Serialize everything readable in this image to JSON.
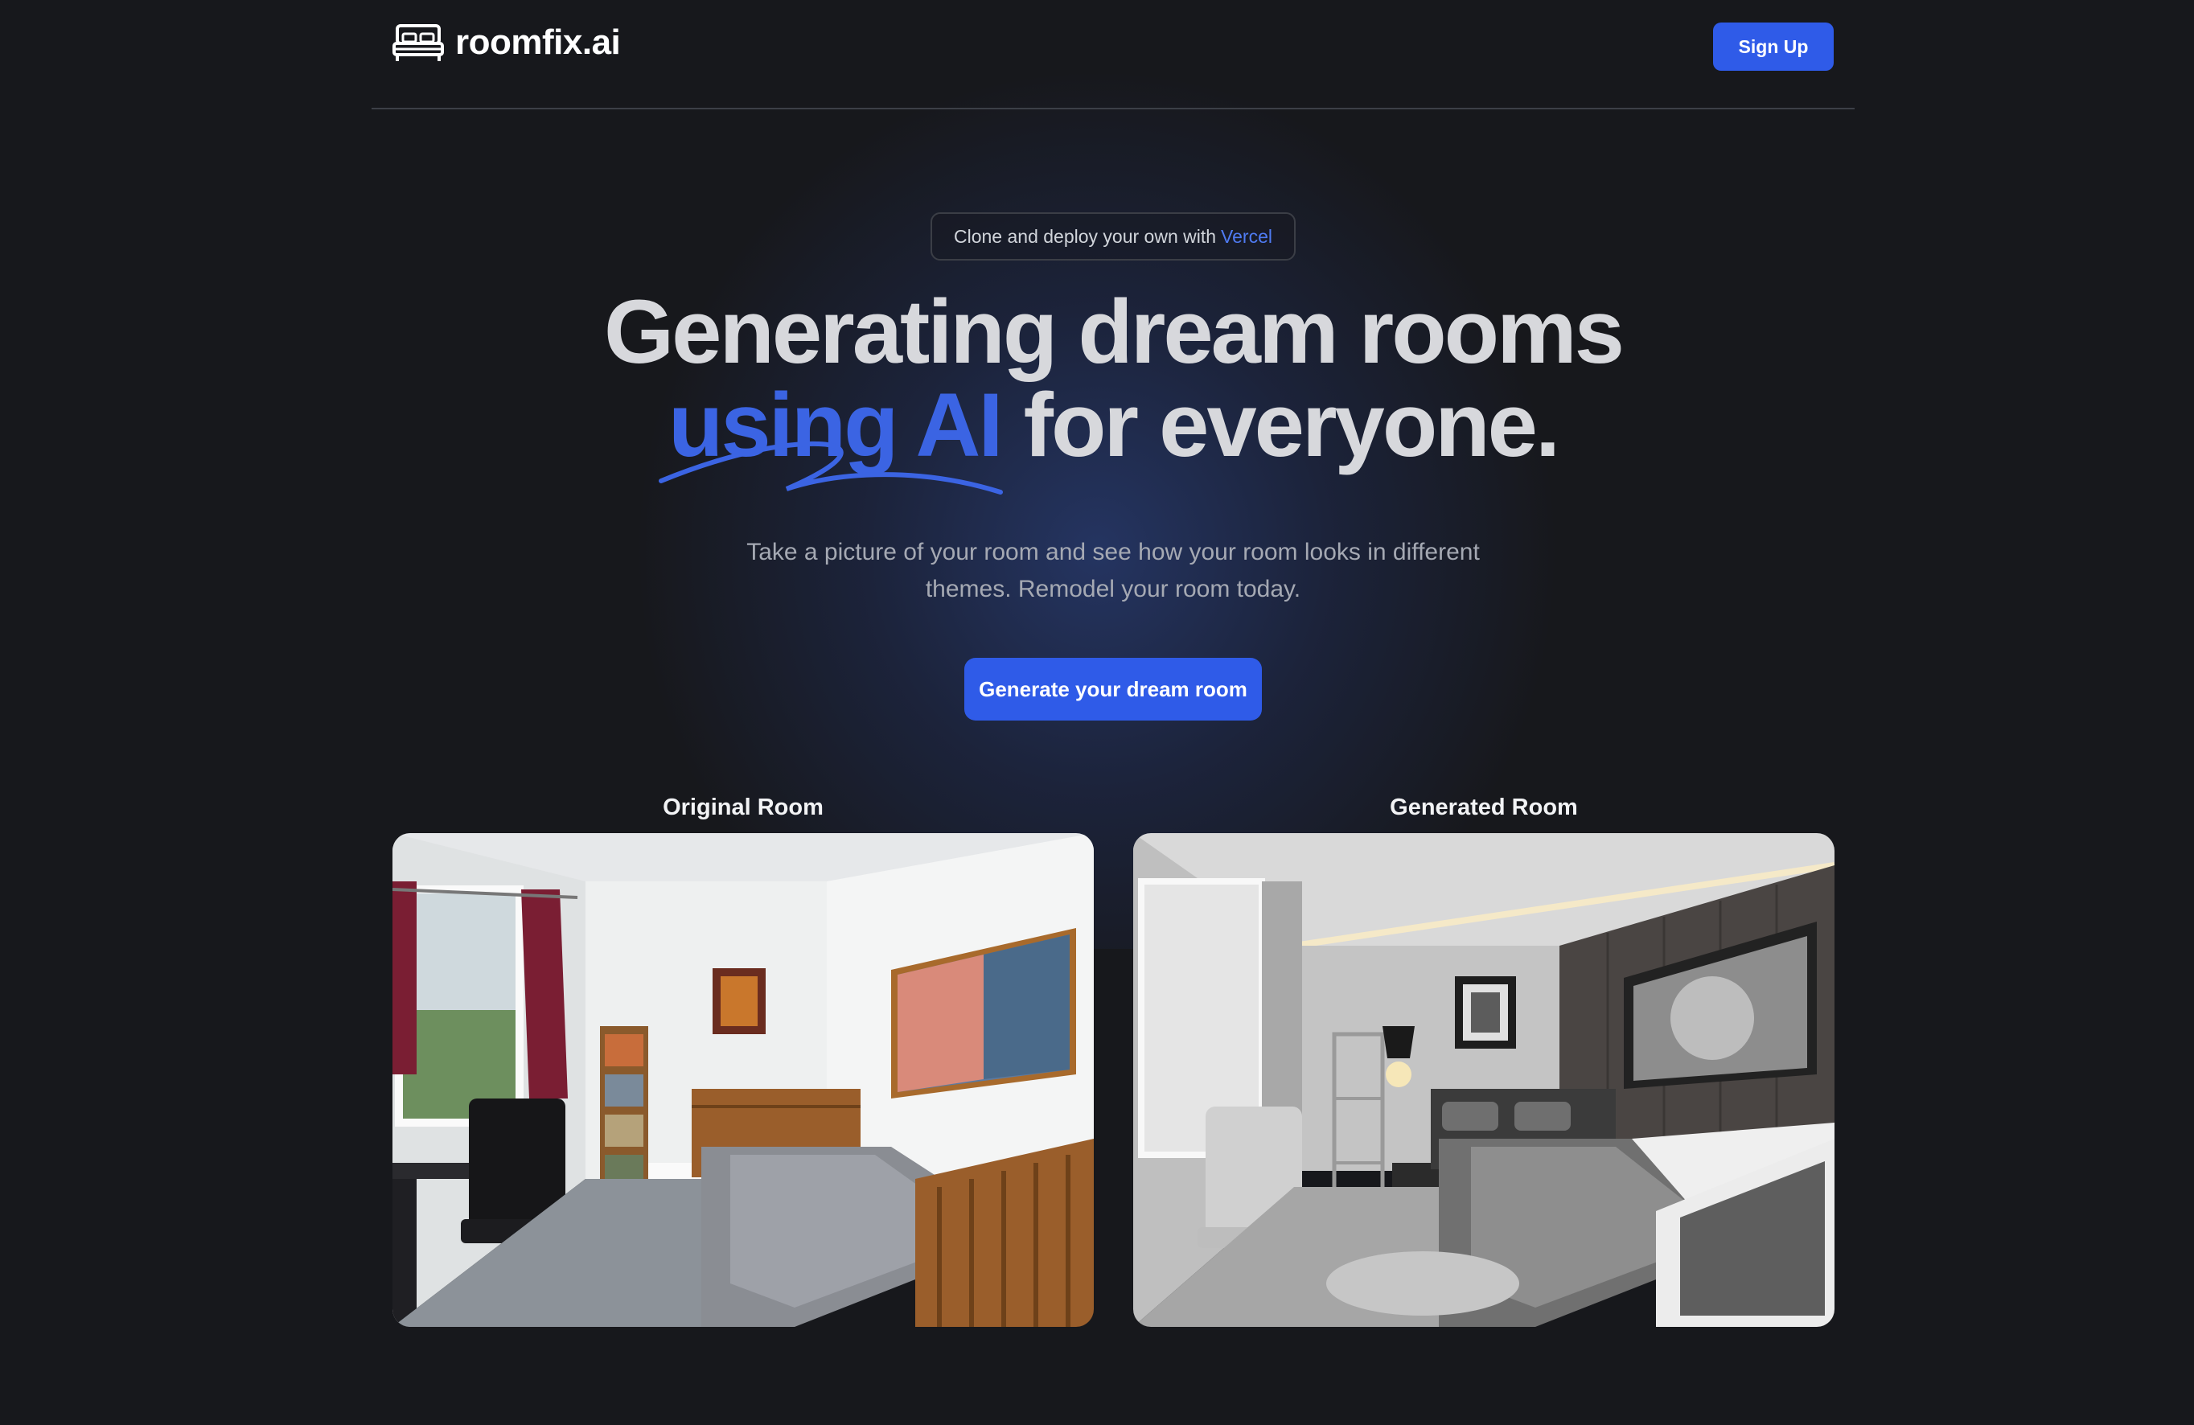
{
  "brand": {
    "name": "roomfix.ai",
    "icon": "bed-icon"
  },
  "header": {
    "signup_label": "Sign Up"
  },
  "announcement": {
    "prefix": "Clone and deploy your own with",
    "link_text": "Vercel"
  },
  "hero": {
    "title_line1": "Generating dream rooms",
    "title_accent": "using AI",
    "title_rest": " for everyone.",
    "subtitle": "Take a picture of your room and see how your room looks in different themes. Remodel your room today.",
    "cta_label": "Generate your dream room"
  },
  "gallery": {
    "original_label": "Original Room",
    "generated_label": "Generated Room"
  },
  "colors": {
    "background": "#17181c",
    "accent": "#2f5be8",
    "accent_text": "#3b64e3",
    "link": "#4f7bf2"
  }
}
